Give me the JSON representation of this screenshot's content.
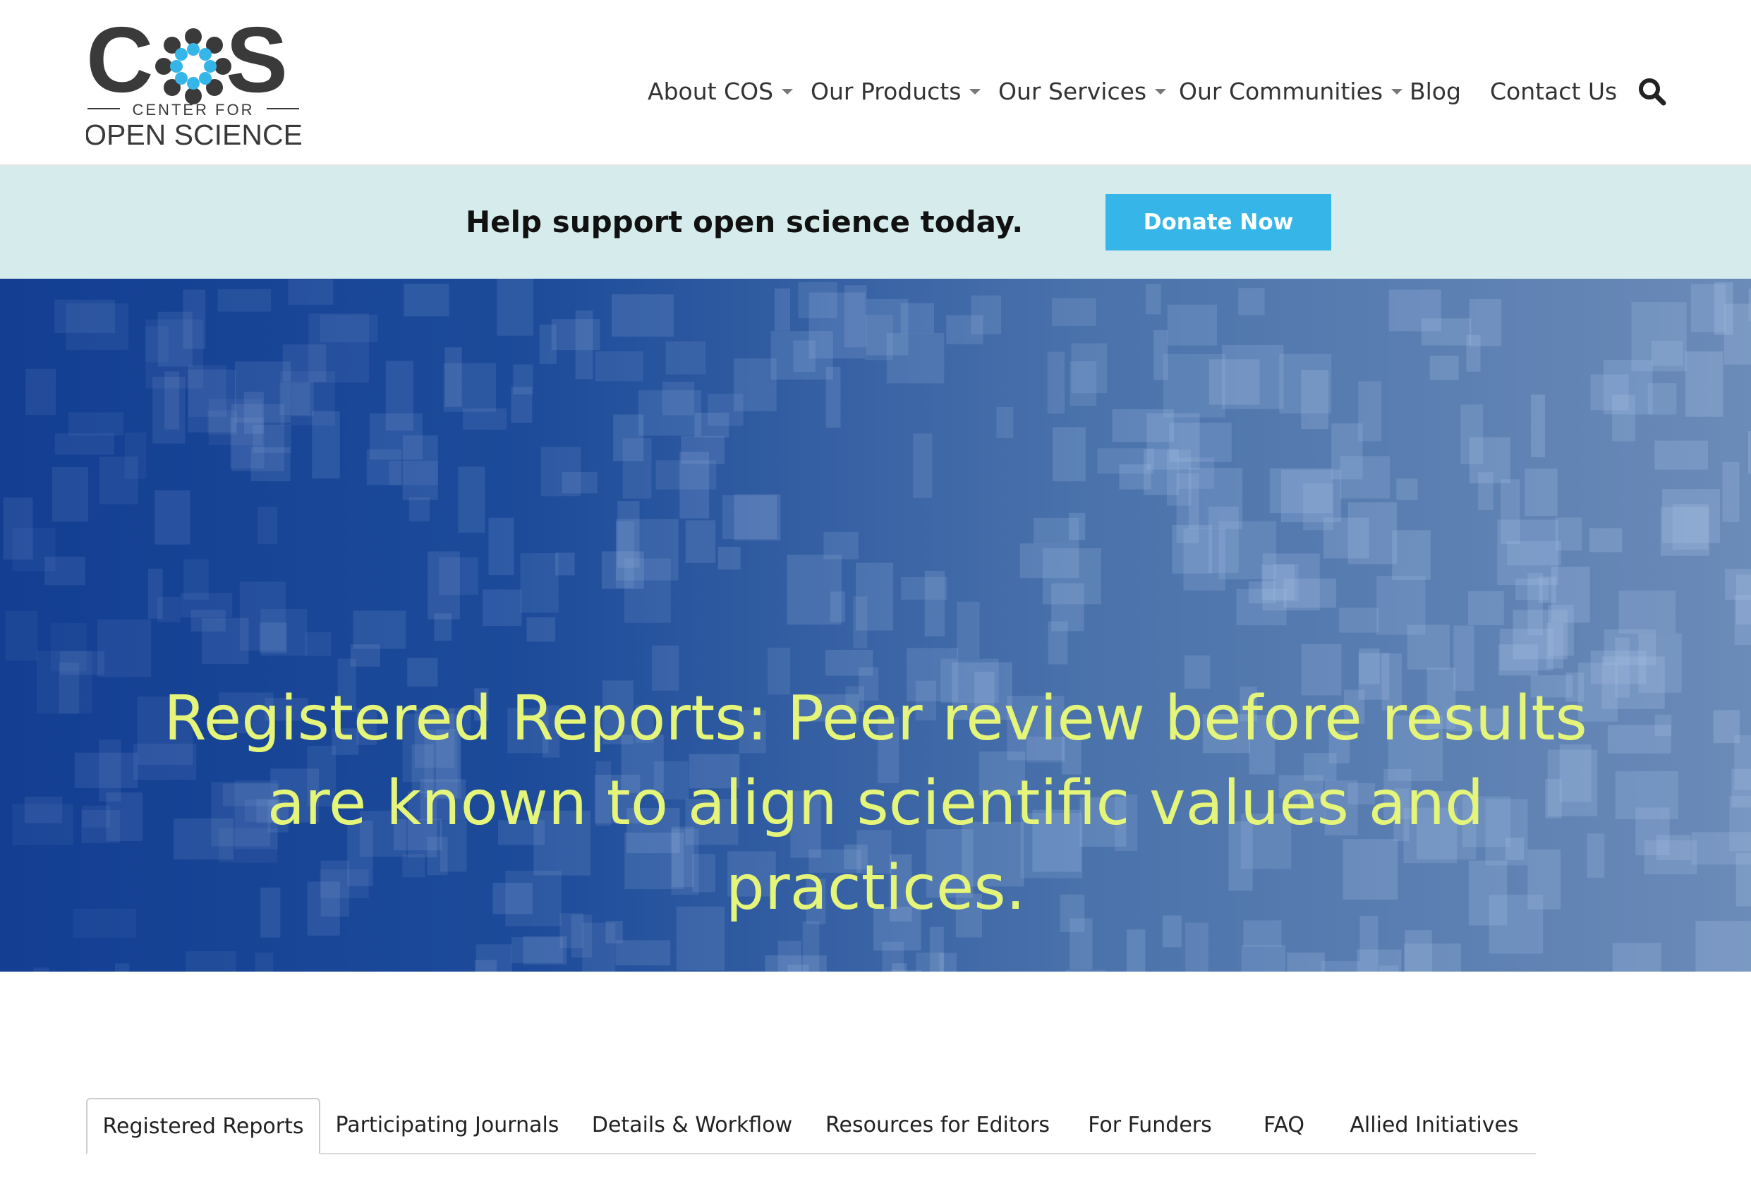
{
  "header": {
    "logo": {
      "wordmark_left": "C",
      "wordmark_right": "S",
      "subtitle_top": "CENTER FOR",
      "subtitle_bottom": "OPEN SCIENCE",
      "brand_color_dark": "#3a3a3a",
      "brand_color_blue": "#36b6e8"
    },
    "nav": [
      {
        "label": "About COS",
        "has_dropdown": true
      },
      {
        "label": "Our Products",
        "has_dropdown": true
      },
      {
        "label": "Our Services",
        "has_dropdown": true
      },
      {
        "label": "Our Communities",
        "has_dropdown": true
      },
      {
        "label": "Blog",
        "has_dropdown": false
      },
      {
        "label": "Contact Us",
        "has_dropdown": false
      }
    ],
    "search_icon": "search-icon"
  },
  "banner": {
    "text": "Help support open science today.",
    "button_label": "Donate Now",
    "background_color": "#d6ecec",
    "button_color": "#36b6e8"
  },
  "hero": {
    "title": "Registered Reports: Peer review before results are known to align scientific values and practices.",
    "title_color": "#e4f57a",
    "background_color": "#1d4b9a"
  },
  "tabs": [
    {
      "label": "Registered Reports",
      "active": true
    },
    {
      "label": "Participating Journals",
      "active": false
    },
    {
      "label": "Details & Workflow",
      "active": false
    },
    {
      "label": "Resources for Editors",
      "active": false
    },
    {
      "label": "For Funders",
      "active": false
    },
    {
      "label": "FAQ",
      "active": false
    },
    {
      "label": "Allied Initiatives",
      "active": false
    }
  ]
}
